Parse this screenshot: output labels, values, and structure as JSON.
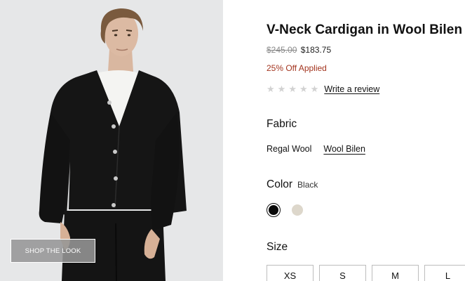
{
  "image": {
    "alt_icon": "product-photo-cardigan",
    "shop_the_look_label": "SHOP THE LOOK"
  },
  "product": {
    "title": "V-Neck Cardigan in Wool Bilen",
    "price_original": "$245.00",
    "price_sale": "$183.75",
    "discount_text": "25% Off Applied",
    "rating": {
      "stars_filled": 0,
      "stars_total": 5,
      "review_link": "Write a review"
    }
  },
  "fabric": {
    "label": "Fabric",
    "options": [
      {
        "label": "Regal Wool",
        "selected": false
      },
      {
        "label": "Wool Bilen",
        "selected": true
      }
    ]
  },
  "color": {
    "label": "Color",
    "selected_value": "Black",
    "swatches": [
      {
        "name": "Black",
        "hex": "#0a0a0a",
        "selected": true
      },
      {
        "name": "Oatmeal",
        "hex": "#ddd7cb",
        "selected": false
      }
    ]
  },
  "size": {
    "label": "Size",
    "options": [
      "XS",
      "S",
      "M",
      "L"
    ]
  },
  "colors": {
    "discount_red": "#a3351f",
    "star_empty": "#d2d2d2",
    "image_background": "#e7e8e9"
  }
}
